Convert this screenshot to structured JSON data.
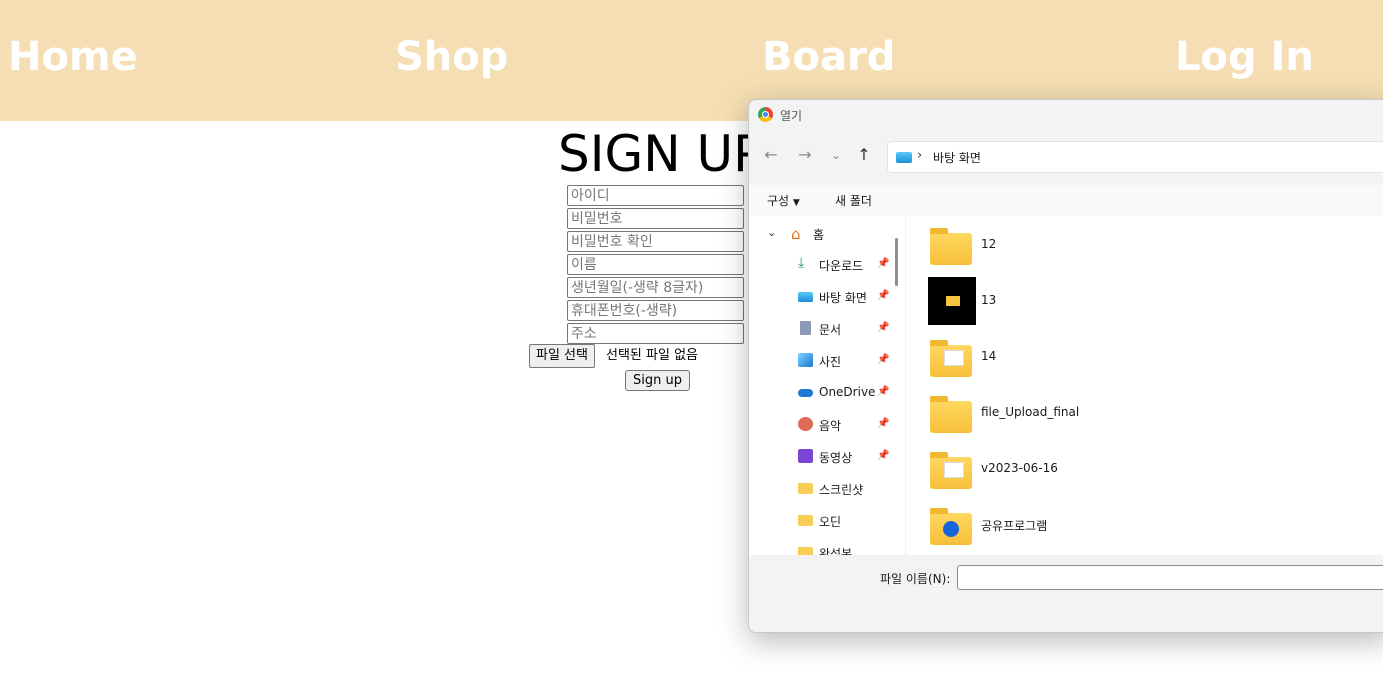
{
  "nav": {
    "home": "Home",
    "shop": "Shop",
    "board": "Board",
    "login": "Log In",
    "bg_color": "#f5deb3"
  },
  "signup": {
    "title": "SIGN UP",
    "fields": {
      "id": "아이디",
      "password": "비밀번호",
      "password_confirm": "비밀번호 확인",
      "name": "이름",
      "birth": "생년월일(-생략 8글자)",
      "phone": "휴대폰번호(-생략)",
      "address": "주소"
    },
    "file_button": "파일 선택",
    "file_status": "선택된 파일 없음",
    "submit": "Sign up"
  },
  "dialog": {
    "title": "열기",
    "address": {
      "separator": "›",
      "location": "바탕 화면"
    },
    "toolbar": {
      "organize": "구성",
      "new_folder": "새 폴더"
    },
    "nav_pane": {
      "home": "홈",
      "items": [
        {
          "label": "다운로드",
          "icon": "download-icon",
          "pinned": true
        },
        {
          "label": "바탕 화면",
          "icon": "desktop-icon",
          "pinned": true
        },
        {
          "label": "문서",
          "icon": "document-icon",
          "pinned": true
        },
        {
          "label": "사진",
          "icon": "picture-icon",
          "pinned": true
        },
        {
          "label": "OneDrive",
          "icon": "cloud-icon",
          "pinned": true
        },
        {
          "label": "음악",
          "icon": "music-icon",
          "pinned": true
        },
        {
          "label": "동영상",
          "icon": "video-icon",
          "pinned": true
        },
        {
          "label": "스크린샷",
          "icon": "folder-icon",
          "pinned": false
        },
        {
          "label": "오딘",
          "icon": "folder-icon",
          "pinned": false
        },
        {
          "label": "완성본",
          "icon": "folder-icon",
          "pinned": false
        }
      ]
    },
    "files": [
      {
        "name": "12",
        "kind": "folder"
      },
      {
        "name": "13",
        "kind": "thumbnail"
      },
      {
        "name": "14",
        "kind": "folder-with-doc"
      },
      {
        "name": "file_Upload_final",
        "kind": "folder"
      },
      {
        "name": "v2023-06-16",
        "kind": "folder-with-doc"
      },
      {
        "name": "공유프로그램",
        "kind": "shared-folder"
      }
    ],
    "filename_label": "파일 이름(N):",
    "filename_value": ""
  }
}
